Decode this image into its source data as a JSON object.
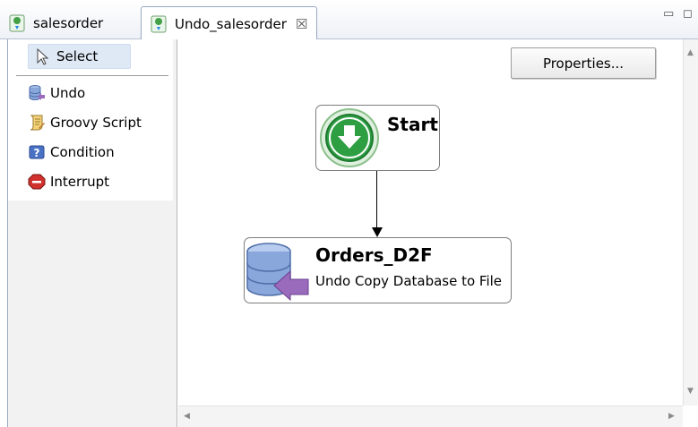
{
  "tabs": [
    {
      "label": "salesorder",
      "active": false,
      "icon": "process-flow-icon"
    },
    {
      "label": "Undo_salesorder",
      "active": true,
      "icon": "process-flow-icon",
      "close_glyph": "☒"
    }
  ],
  "window_controls": {
    "minimize_glyph": "▭",
    "maximize_glyph": "◻"
  },
  "palette": {
    "select_label": "Select",
    "items": [
      {
        "label": "Undo",
        "icon": "database-undo-icon"
      },
      {
        "label": "Groovy Script",
        "icon": "script-icon"
      },
      {
        "label": "Condition",
        "icon": "condition-icon"
      },
      {
        "label": "Interrupt",
        "icon": "interrupt-stop-icon"
      }
    ]
  },
  "canvas": {
    "properties_button": "Properties...",
    "nodes": {
      "start": {
        "title": "Start",
        "icon": "start-arrow-icon"
      },
      "orders": {
        "title": "Orders_D2F",
        "subtitle": "Undo Copy Database to File",
        "icon": "database-undo-icon"
      }
    }
  },
  "colors": {
    "start_green": "#2e9e43",
    "db_blue": "#7f9fd6",
    "undo_purple": "#9a6bbd",
    "select_highlight": "#dfe9f5"
  }
}
